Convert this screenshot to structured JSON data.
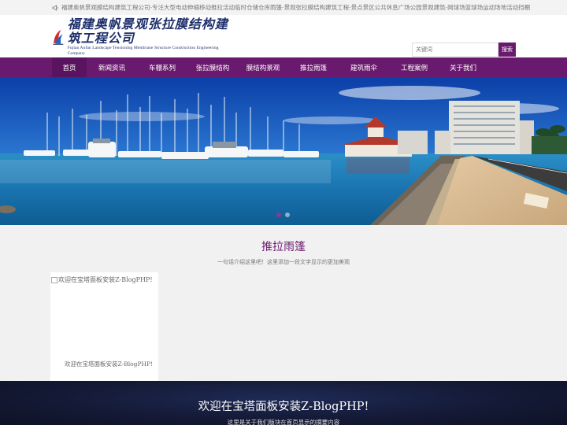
{
  "topbar": {
    "text": "福建奥帆景观膜结构建筑工程公司-专注大型电动伸缩移动推拉活动临时仓储仓库雨篷-景观张拉膜结构建筑工程-景点景区公共休息广场公园景观建筑-网球场篮球场运动场地活动挡棚",
    "icon": "speaker-icon"
  },
  "logo": {
    "cn": "福建奥帆景观张拉膜结构建筑工程公司",
    "en": "Fujian Aofan Landscape Tensioning Membrane Structure Construction Engineering Company",
    "colors": {
      "navy": "#1d2f6b",
      "red": "#d22b2b",
      "blue": "#1f66c4"
    }
  },
  "search": {
    "placeholder": "关键词",
    "button": "搜索"
  },
  "nav": {
    "items": [
      {
        "label": "首页",
        "active": true
      },
      {
        "label": "新闻资讯",
        "active": false
      },
      {
        "label": "车棚系列",
        "active": false
      },
      {
        "label": "张拉膜结构",
        "active": false
      },
      {
        "label": "膜结构景观",
        "active": false
      },
      {
        "label": "推拉雨篷",
        "active": false
      },
      {
        "label": "建筑雨伞",
        "active": false
      },
      {
        "label": "工程案例",
        "active": false
      },
      {
        "label": "关于我们",
        "active": false
      }
    ],
    "accent": "#6a1a6e"
  },
  "banner": {
    "slides": 2,
    "current": 1
  },
  "section": {
    "title": "推拉雨篷",
    "subtitle": "一句话介绍这里吧！这里添加一段文字显示的更加美观"
  },
  "card": {
    "img_alt": "欢迎在宝塔面板安装Z-BlogPHP!",
    "caption": "欢迎在宝塔面板安装Z-BlogPHP!"
  },
  "dark_band": {
    "title": "欢迎在宝塔面板安装Z-BlogPHP!",
    "subtitle": "这里是关于我们版块在首页显示的摘要内容"
  }
}
